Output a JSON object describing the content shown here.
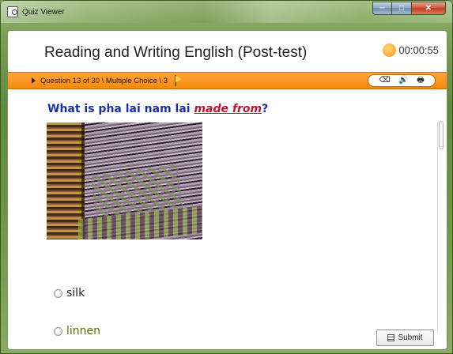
{
  "window": {
    "title": "Quiz Viewer",
    "controls": {
      "minimize": "─",
      "maximize": "□",
      "close": "✕"
    }
  },
  "header": {
    "quiz_title": "Reading and Writing English (Post-test)",
    "timer": "00:00:55"
  },
  "question_bar": {
    "info": "Question 13 of 30 \\ Multiple Choice \\ 3",
    "tools": [
      {
        "name": "eraser-icon",
        "glyph": "⌫"
      },
      {
        "name": "speaker-icon",
        "glyph": "🔊"
      },
      {
        "name": "print-icon",
        "glyph": "🖶"
      }
    ]
  },
  "question": {
    "prefix": "What is pha lai nam lai ",
    "emphasis": "made from",
    "suffix": "?"
  },
  "options": [
    {
      "label": "silk"
    },
    {
      "label": "linnen"
    }
  ],
  "actions": {
    "submit": "Submit"
  },
  "colors": {
    "accent_orange": "#f58a0c",
    "question_blue": "#1a2fb0",
    "emphasis_red": "#c8102e"
  }
}
